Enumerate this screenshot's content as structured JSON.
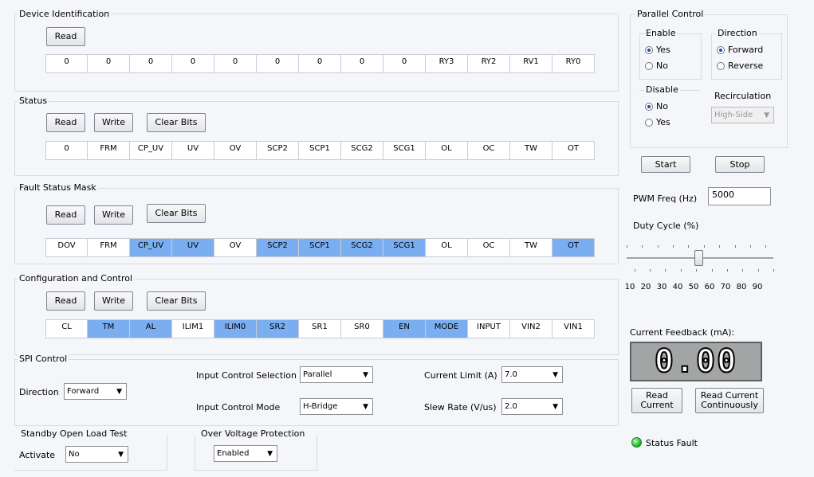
{
  "device_id": {
    "title": "Device Identification",
    "read_label": "Read",
    "bits": [
      "0",
      "0",
      "0",
      "0",
      "0",
      "0",
      "0",
      "0",
      "0",
      "RY3",
      "RY2",
      "RV1",
      "RY0"
    ]
  },
  "status": {
    "title": "Status",
    "read_label": "Read",
    "write_label": "Write",
    "clear_label": "Clear Bits",
    "bits": [
      "0",
      "FRM",
      "CP_UV",
      "UV",
      "OV",
      "SCP2",
      "SCP1",
      "SCG2",
      "SCG1",
      "OL",
      "OC",
      "TW",
      "OT"
    ]
  },
  "fault_mask": {
    "title": "Fault Status Mask",
    "read_label": "Read",
    "write_label": "Write",
    "clear_label": "Clear Bits",
    "bits": [
      "DOV",
      "FRM",
      "CP_UV",
      "UV",
      "OV",
      "SCP2",
      "SCP1",
      "SCG2",
      "SCG1",
      "OL",
      "OC",
      "TW",
      "OT"
    ],
    "highlighted": [
      2,
      3,
      5,
      6,
      7,
      8,
      12
    ]
  },
  "config": {
    "title": "Configuration and Control",
    "read_label": "Read",
    "write_label": "Write",
    "clear_label": "Clear Bits",
    "bits": [
      "CL",
      "TM",
      "AL",
      "ILIM1",
      "ILIM0",
      "SR2",
      "SR1",
      "SR0",
      "EN",
      "MODE",
      "INPUT",
      "VIN2",
      "VIN1"
    ],
    "highlighted": [
      1,
      2,
      4,
      5,
      8,
      9
    ]
  },
  "spi": {
    "title": "SPI Control",
    "direction_label": "Direction",
    "direction_value": "Forward",
    "input_sel_label": "Input Control Selection",
    "input_sel_value": "Parallel",
    "input_mode_label": "Input Control Mode",
    "input_mode_value": "H-Bridge",
    "current_limit_label": "Current Limit (A)",
    "current_limit_value": "7.0",
    "slew_rate_label": "Slew Rate (V/us)",
    "slew_rate_value": "2.0"
  },
  "standby": {
    "title": "Standby Open Load Test",
    "activate_label": "Activate",
    "activate_value": "No"
  },
  "ovp": {
    "title": "Over Voltage Protection",
    "value": "Enabled"
  },
  "parallel": {
    "title": "Parallel Control",
    "enable_title": "Enable",
    "enable_yes": "Yes",
    "enable_no": "No",
    "direction_title": "Direction",
    "dir_forward": "Forward",
    "dir_reverse": "Reverse",
    "disable_title": "Disable",
    "disable_no": "No",
    "disable_yes": "Yes",
    "recirc_title": "Recirculation",
    "recirc_value": "High-Side",
    "start_label": "Start",
    "stop_label": "Stop"
  },
  "pwm": {
    "freq_label": "PWM Freq (Hz)",
    "freq_value": "5000",
    "duty_label": "Duty Cycle (%)",
    "duty_value": 50,
    "ticks": [
      "10",
      "20",
      "30",
      "40",
      "50",
      "60",
      "70",
      "80",
      "90"
    ]
  },
  "feedback": {
    "label": "Current Feedback (mA):",
    "value": "0.00",
    "read_label": "Read Current",
    "read_cont_label": "Read Current Continuously",
    "fault_label": "Status Fault"
  }
}
